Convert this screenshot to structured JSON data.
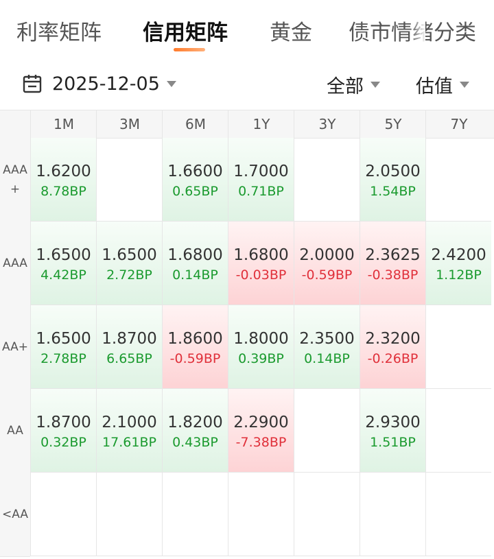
{
  "tabs": [
    {
      "label": "利率矩阵",
      "active": false
    },
    {
      "label": "信用矩阵",
      "active": true
    },
    {
      "label": "黄金",
      "active": false
    },
    {
      "label": "债市情绪",
      "active": false
    },
    {
      "label": "分类",
      "active": false
    }
  ],
  "filters": {
    "date": "2025-12-05",
    "scope": "全部",
    "mode": "估值"
  },
  "colors": {
    "up": "#1a9a2e",
    "down": "#e0303a",
    "accent": "#ff7a2b"
  },
  "grid": {
    "columns": [
      "1M",
      "3M",
      "6M",
      "1Y",
      "3Y",
      "5Y",
      "7Y"
    ],
    "rows": [
      {
        "label": "AAA\n+",
        "cells": [
          {
            "value": "1.6200",
            "change": "8.78BP",
            "dir": "up"
          },
          null,
          {
            "value": "1.6600",
            "change": "0.65BP",
            "dir": "up"
          },
          {
            "value": "1.7000",
            "change": "0.71BP",
            "dir": "up"
          },
          null,
          {
            "value": "2.0500",
            "change": "1.54BP",
            "dir": "up"
          },
          null
        ]
      },
      {
        "label": "AAA",
        "cells": [
          {
            "value": "1.6500",
            "change": "4.42BP",
            "dir": "up"
          },
          {
            "value": "1.6500",
            "change": "2.72BP",
            "dir": "up"
          },
          {
            "value": "1.6800",
            "change": "0.14BP",
            "dir": "up"
          },
          {
            "value": "1.6800",
            "change": "-0.03BP",
            "dir": "down"
          },
          {
            "value": "2.0000",
            "change": "-0.59BP",
            "dir": "down"
          },
          {
            "value": "2.3625",
            "change": "-0.38BP",
            "dir": "down"
          },
          {
            "value": "2.4200",
            "change": "1.12BP",
            "dir": "up"
          }
        ]
      },
      {
        "label": "AA+",
        "cells": [
          {
            "value": "1.6500",
            "change": "2.78BP",
            "dir": "up"
          },
          {
            "value": "1.8700",
            "change": "6.65BP",
            "dir": "up"
          },
          {
            "value": "1.8600",
            "change": "-0.59BP",
            "dir": "down"
          },
          {
            "value": "1.8000",
            "change": "0.39BP",
            "dir": "up"
          },
          {
            "value": "2.3500",
            "change": "0.14BP",
            "dir": "up"
          },
          {
            "value": "2.3200",
            "change": "-0.26BP",
            "dir": "down"
          },
          null
        ]
      },
      {
        "label": "AA",
        "cells": [
          {
            "value": "1.8700",
            "change": "0.32BP",
            "dir": "up"
          },
          {
            "value": "2.1000",
            "change": "17.61BP",
            "dir": "up"
          },
          {
            "value": "1.8200",
            "change": "0.43BP",
            "dir": "up"
          },
          {
            "value": "2.2900",
            "change": "-7.38BP",
            "dir": "down"
          },
          null,
          {
            "value": "2.9300",
            "change": "1.51BP",
            "dir": "up"
          },
          null
        ]
      },
      {
        "label": "<AA",
        "cells": [
          null,
          null,
          null,
          null,
          null,
          null,
          null
        ]
      }
    ]
  }
}
